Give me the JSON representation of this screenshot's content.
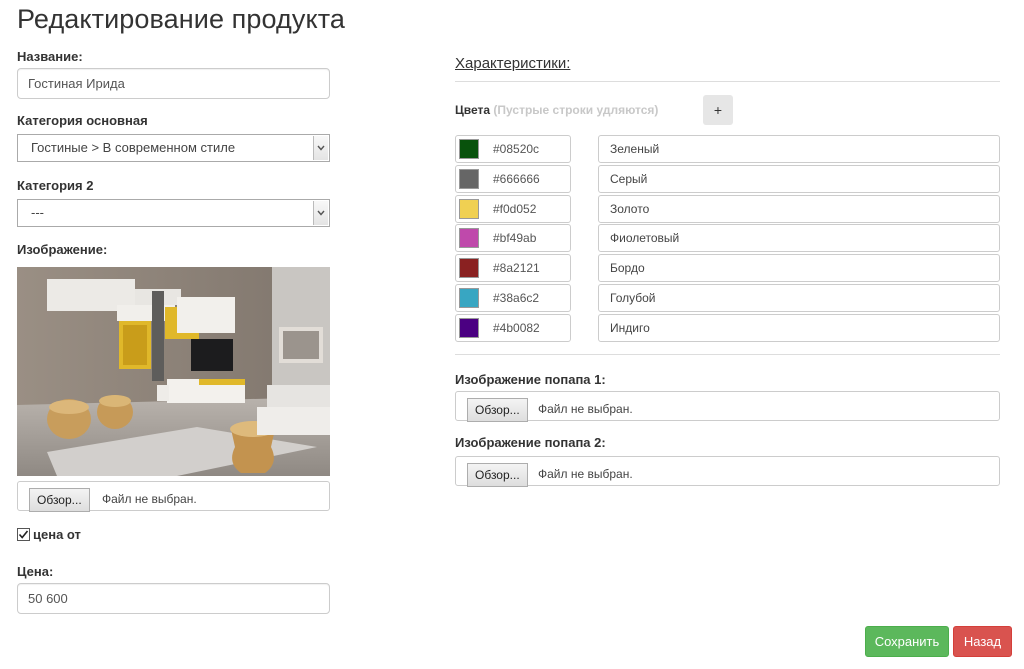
{
  "page": {
    "title": "Редактирование продукта"
  },
  "name_field": {
    "label": "Название:",
    "value": "Гостиная Ирида"
  },
  "category_main": {
    "label": "Категория основная",
    "value": "Гостиные > В современном стиле"
  },
  "category_2": {
    "label": "Категория 2",
    "value": "---"
  },
  "image": {
    "label": "Изображение:",
    "browse_label": "Обзор...",
    "file_status": "Файл не выбран."
  },
  "price_from": {
    "checked": true,
    "label": "цена от"
  },
  "price": {
    "label": "Цена:",
    "value": "50 600"
  },
  "specs": {
    "title": "Характеристики:",
    "colors_label": "Цвета",
    "colors_hint": "(Пустрые строки удляются)",
    "add_label": "+",
    "colors": [
      {
        "hex": "#08520c",
        "name": "Зеленый"
      },
      {
        "hex": "#666666",
        "name": "Серый"
      },
      {
        "hex": "#f0d052",
        "name": "Золото"
      },
      {
        "hex": "#bf49ab",
        "name": "Фиолетовый"
      },
      {
        "hex": "#8a2121",
        "name": "Бордо"
      },
      {
        "hex": "#38a6c2",
        "name": "Голубой"
      },
      {
        "hex": "#4b0082",
        "name": "Индиго"
      }
    ]
  },
  "popup_image_1": {
    "label": "Изображение попапа 1:",
    "browse_label": "Обзор...",
    "file_status": "Файл не выбран."
  },
  "popup_image_2": {
    "label": "Изображение попапа 2:",
    "browse_label": "Обзор...",
    "file_status": "Файл не выбран."
  },
  "actions": {
    "save_label": "Сохранить",
    "back_label": "Назад",
    "save_color": "#5cb85c",
    "back_color": "#d9534f"
  }
}
